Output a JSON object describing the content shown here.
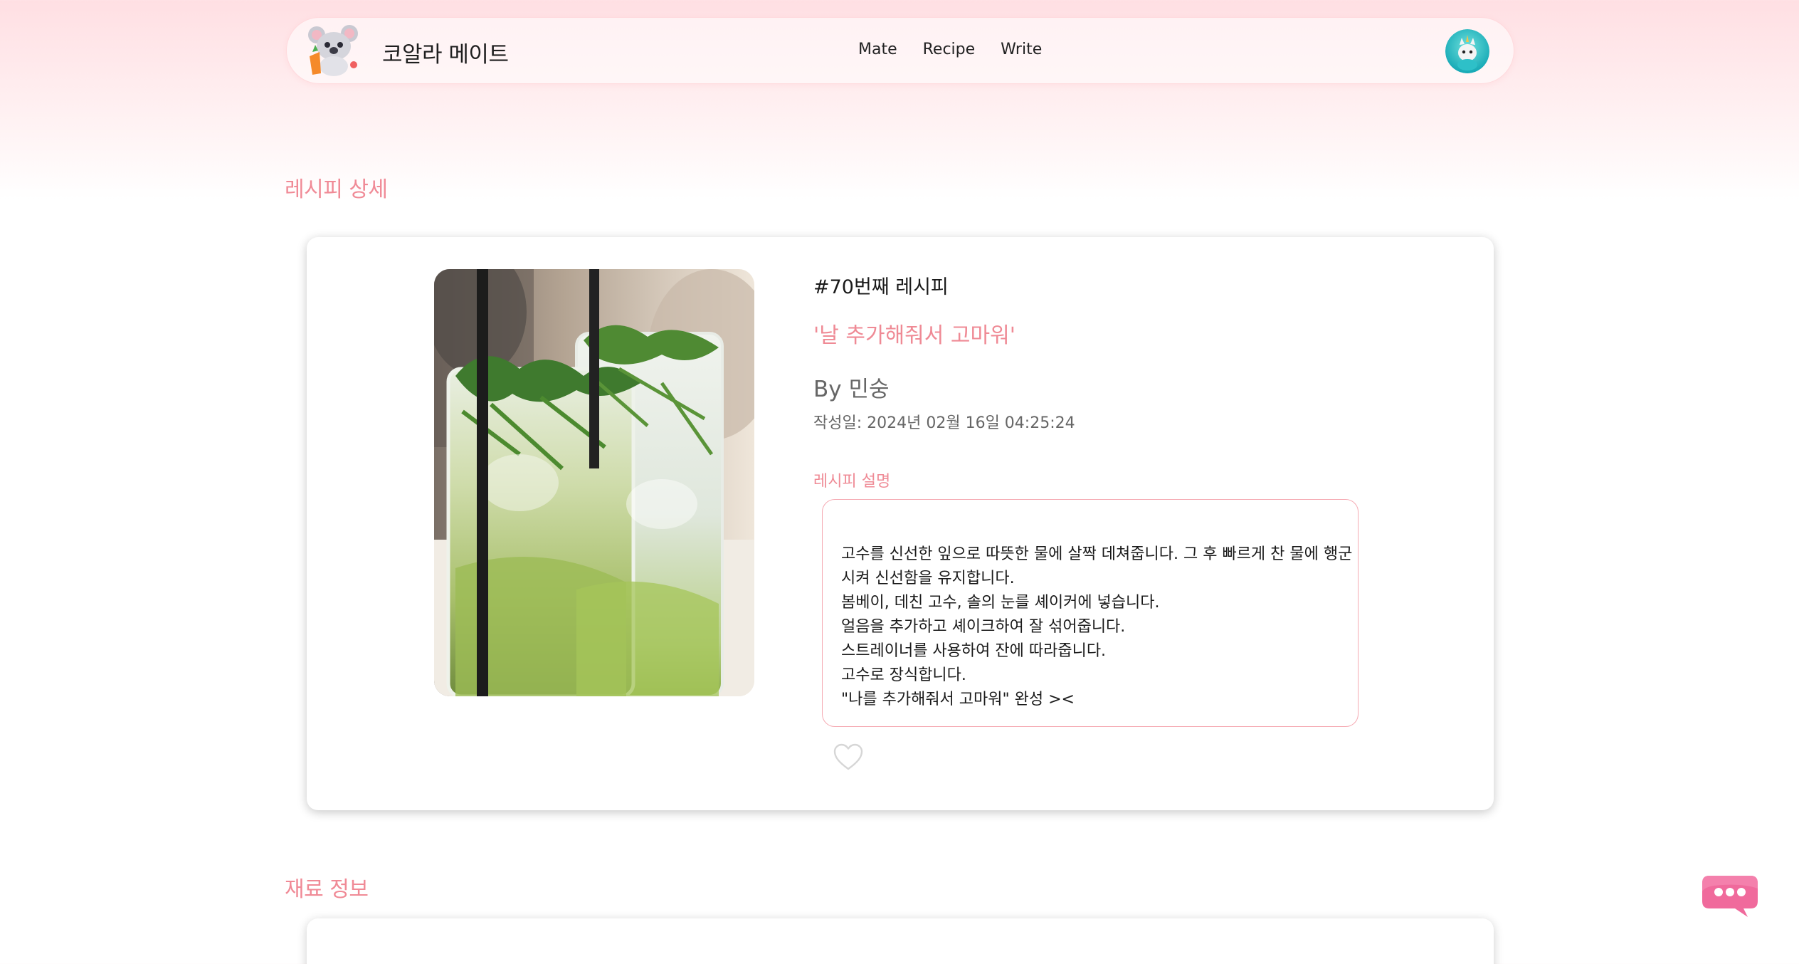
{
  "header": {
    "brand": "코알라 메이트",
    "nav": [
      "Mate",
      "Recipe",
      "Write"
    ]
  },
  "page": {
    "detail_title": "레시피 상세",
    "ingredients_title": "재료 정보"
  },
  "recipe": {
    "number": "#70번째 레시피",
    "title": "'날 추가해줘서 고마워'",
    "author": "By 민숭",
    "created": "작성일: 2024년 02월 16일 04:25:24",
    "description_label": "레시피 설명",
    "description_lines": [
      "고수를 신선한 잎으로 따뜻한 물에 살짝 데쳐줍니다. 그 후 빠르게 찬 물에 행군",
      "시켜 신선함을 유지합니다.",
      "봄베이, 데친 고수, 솔의 눈를 셰이커에 넣습니다.",
      "얼음을 추가하고 셰이크하여 잘 섞어줍니다.",
      "스트레이너를 사용하여 잔에 따라줍니다.",
      "고수로 장식합니다.",
      "\"나를 추가해줘서 고마워\" 완성 ><"
    ],
    "liked": false
  },
  "icons": {
    "like": "heart-outline-icon",
    "chat": "chat-bubble-icon"
  },
  "colors": {
    "accent": "#f08a96",
    "chat": "#f06a9c"
  }
}
